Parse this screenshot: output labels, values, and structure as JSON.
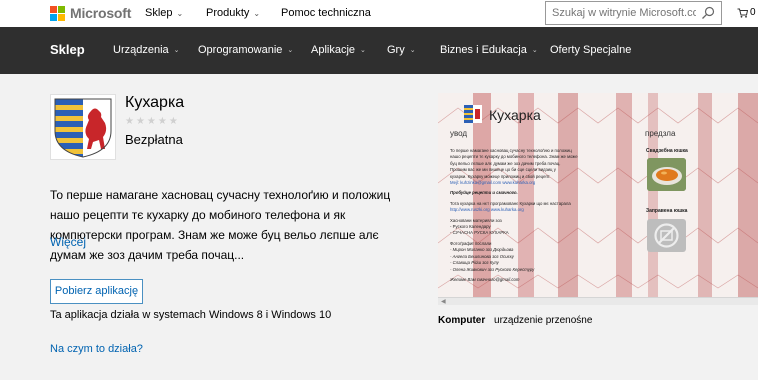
{
  "header": {
    "brand": "Microsoft",
    "nav": [
      {
        "label": "Sklep",
        "has_menu": true
      },
      {
        "label": "Produkty",
        "has_menu": true
      },
      {
        "label": "Pomoc techniczna",
        "has_menu": false
      }
    ],
    "search": {
      "placeholder": "Szukaj w witrynie Microsoft.com",
      "value": ""
    },
    "cart_count": "0"
  },
  "store_nav": {
    "title": "Sklep",
    "items": [
      {
        "label": "Urządzenia"
      },
      {
        "label": "Oprogramowanie"
      },
      {
        "label": "Aplikacje"
      },
      {
        "label": "Gry"
      },
      {
        "label": "Biznes i Edukacja"
      },
      {
        "label": "Oferty Specjalne"
      }
    ]
  },
  "app": {
    "name": "Кухарка",
    "rating_stars": 5,
    "rating_filled": 0,
    "price": "Bezpłatna",
    "description": "То перше намагане хасновац сучасну технолоґию и положиц нашо рецепти тє кухарку до мобиного телефона и як компютерски програм. Знам же може буц вельо лєпше алє думам же зоз дачим треба почац...",
    "more_link": "Więcej",
    "get_button": "Pobierz aplikację",
    "works_on": "Ta aplikacja działa w systemach Windows 8 i Windows 10",
    "how_link": "Na czym to działa?"
  },
  "screenshot": {
    "app_title": "Кухарка",
    "left_heading": "увод",
    "right_heading": "предзлa",
    "body_lines": [
      "То перше намагане хасновац сучасну технолоґию и положиц",
      "нашо рецепти тє кухарку до мобиного телефона. Знам же може",
      "буц вельо лєпше алє думам же зоз дачим треба почац.",
      "Прошим вас же ми пишеце цо би сце сцели видзиц у",
      "кухарки. Кухарку можеце приложиц и свой рецепт.",
      "Mejl: kuhzinka@gmail.com  www.kuharka.org"
    ],
    "section_title": "Пробуйце рецепти и смачного.",
    "extra_lines": [
      "Тота кухарка на нєт програмованє Кухарки що мє настарала",
      "http://www.ruszki.org  www.kuharka.org"
    ],
    "list_heading": "Хасновани материяли зоз",
    "list_items": [
      "- Руского Календару",
      "- СУЧАСНА РУСКА КУХАРКА"
    ],
    "photo_heading": "Фотоґрафиї послали",
    "photo_items": [
      "- Мирон Миланко зоз Дюрдьова",
      "- Ангела Бешлинова зоз Осиєку",
      "- Славица Рійш зоз Кулу",
      "- Олена Живкович зоз Руского Керестуру"
    ],
    "footer_line": "Желиме Вам смачного@gmail.com",
    "right_caption_1": "Свадзебна юшка",
    "right_caption_2": "Заправена юшка"
  },
  "devices": {
    "active": "Komputer",
    "other": "urządzenie przenośne"
  },
  "colors": {
    "store_nav_bg": "#2f2f2f",
    "link_blue": "#0063b1",
    "ms_red": "#f25022",
    "ms_green": "#7fba00",
    "ms_blue": "#00a4ef",
    "ms_yellow": "#ffb900"
  }
}
